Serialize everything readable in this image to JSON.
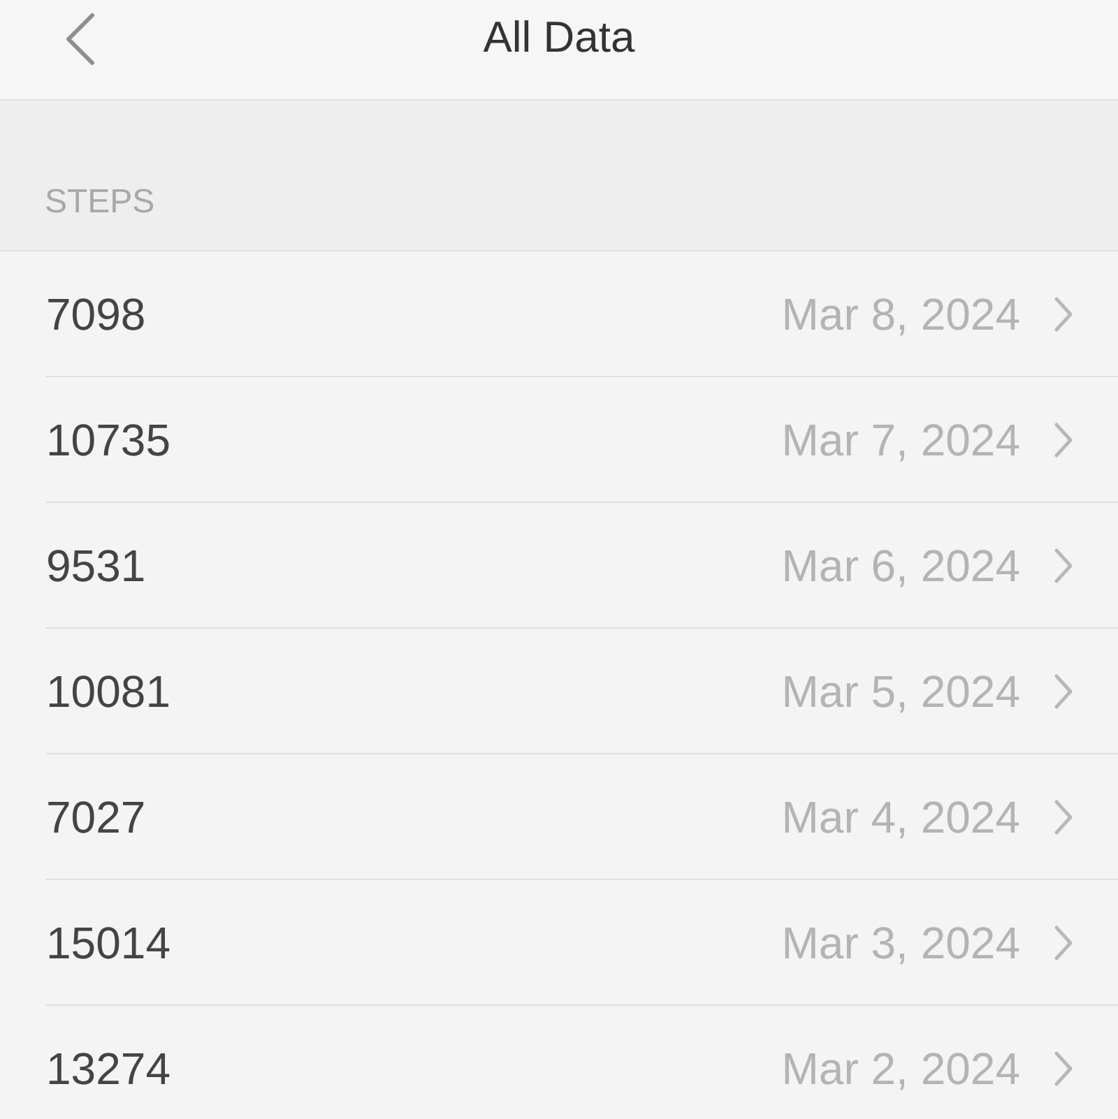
{
  "header": {
    "title": "All Data"
  },
  "section": {
    "title": "STEPS"
  },
  "rows": [
    {
      "value": "7098",
      "date": "Mar 8, 2024"
    },
    {
      "value": "10735",
      "date": "Mar 7, 2024"
    },
    {
      "value": "9531",
      "date": "Mar 6, 2024"
    },
    {
      "value": "10081",
      "date": "Mar 5, 2024"
    },
    {
      "value": "7027",
      "date": "Mar 4, 2024"
    },
    {
      "value": "15014",
      "date": "Mar 3, 2024"
    },
    {
      "value": "13274",
      "date": "Mar 2, 2024"
    }
  ]
}
